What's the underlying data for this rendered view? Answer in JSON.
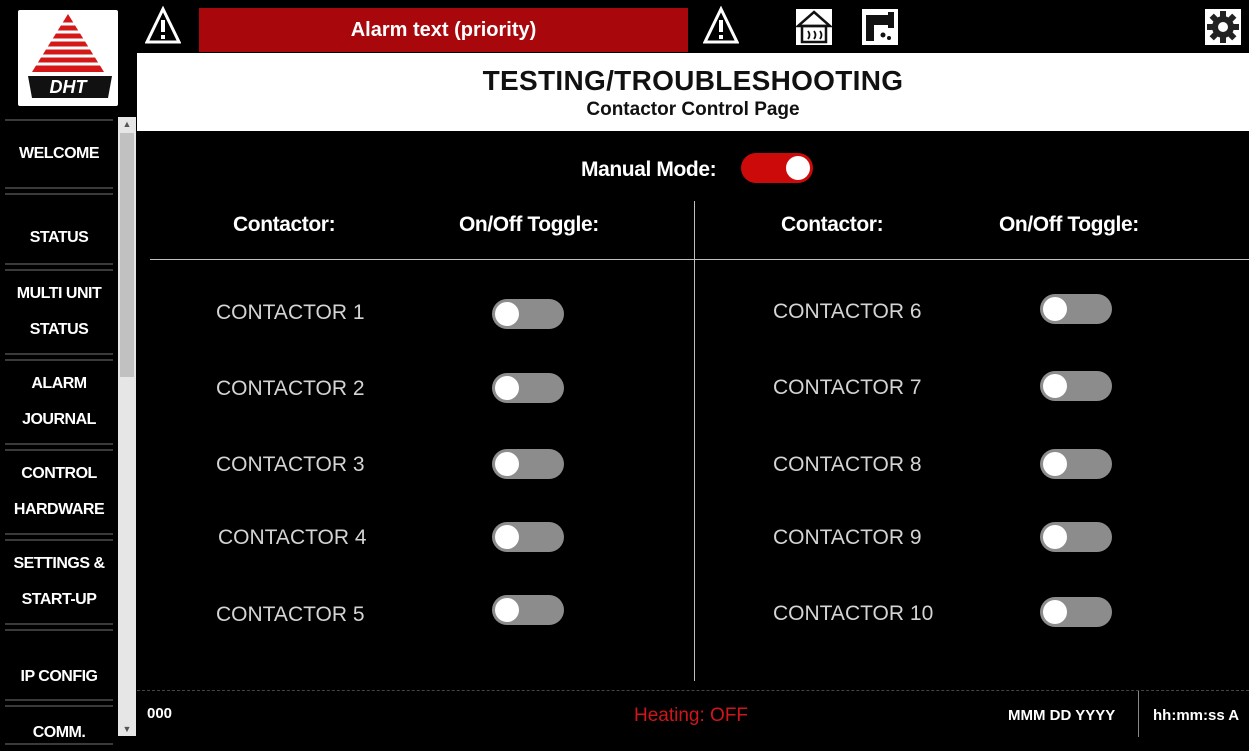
{
  "logo_text": "DHT",
  "header": {
    "alarm_text": "Alarm text (priority)",
    "icons": [
      "warning-icon",
      "warning-icon",
      "house-heating-icon",
      "pipe-icon",
      "gear-icon"
    ]
  },
  "page": {
    "title": "TESTING/TROUBLESHOOTING",
    "subtitle": "Contactor Control Page"
  },
  "sidebar": {
    "items": [
      {
        "label": "WELCOME"
      },
      {
        "label": "STATUS"
      },
      {
        "label_line1": "MULTI UNIT",
        "label_line2": "STATUS"
      },
      {
        "label_line1": "ALARM",
        "label_line2": "JOURNAL"
      },
      {
        "label_line1": "CONTROL",
        "label_line2": "HARDWARE"
      },
      {
        "label_line1": "SETTINGS &",
        "label_line2": "START-UP"
      },
      {
        "label": "IP CONFIG"
      },
      {
        "label": "COMM."
      }
    ]
  },
  "manual_mode": {
    "label": "Manual Mode:",
    "on": true
  },
  "columns": {
    "left_header": "Contactor:",
    "left_toggle_header": "On/Off Toggle:",
    "right_header": "Contactor:",
    "right_toggle_header": "On/Off Toggle:"
  },
  "contactors": [
    {
      "name": "CONTACTOR 1",
      "on": false
    },
    {
      "name": "CONTACTOR 2",
      "on": false
    },
    {
      "name": "CONTACTOR 3",
      "on": false
    },
    {
      "name": "CONTACTOR 4",
      "on": false
    },
    {
      "name": "CONTACTOR 5",
      "on": false
    },
    {
      "name": "CONTACTOR 6",
      "on": false
    },
    {
      "name": "CONTACTOR 7",
      "on": false
    },
    {
      "name": "CONTACTOR 8",
      "on": false
    },
    {
      "name": "CONTACTOR 9",
      "on": false
    },
    {
      "name": "CONTACTOR 10",
      "on": false
    }
  ],
  "status_bar": {
    "code": "000",
    "heating": "Heating: OFF",
    "date": "MMM DD YYYY",
    "time": "hh:mm:ss A"
  },
  "colors": {
    "alarm_red": "#a8070b",
    "toggle_on": "#cc0a0a",
    "toggle_off": "#8c8c8c",
    "heating_red": "#d0151b"
  }
}
